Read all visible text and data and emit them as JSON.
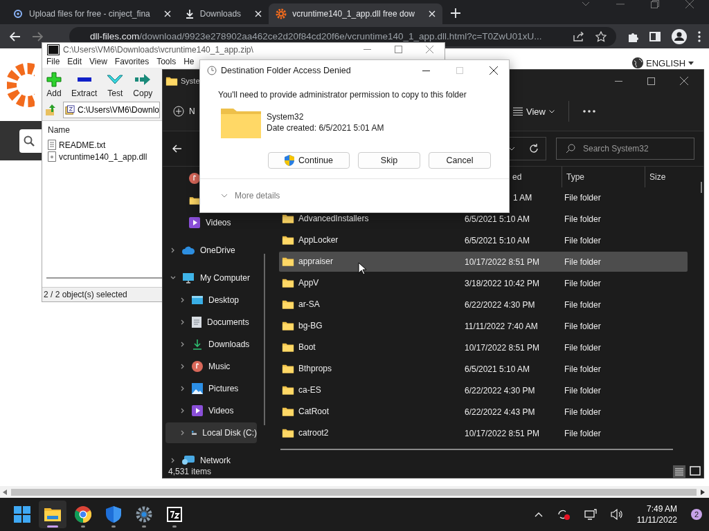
{
  "browser": {
    "tabs": [
      {
        "title": "Upload files for free - cinject_fina",
        "kind": "cloud",
        "selected": false
      },
      {
        "title": "Downloads",
        "kind": "download",
        "selected": false
      },
      {
        "title": "vcruntime140_1_app.dll free dow",
        "kind": "gear",
        "selected": true
      }
    ],
    "address": {
      "host": "dll-files.com",
      "path": "/download/9923e278902aa462ce2d20f84cd20f6e/vcruntime140_1_app.dll.html?c=T0ZwU01xU..."
    },
    "language": "ENGLISH"
  },
  "archive_window": {
    "title": "C:\\Users\\VM6\\Downloads\\vcruntime140_1_app.zip\\",
    "menu": [
      "File",
      "Edit",
      "View",
      "Favorites",
      "Tools",
      "He"
    ],
    "toolbar": [
      {
        "label": "Add",
        "kind": "add"
      },
      {
        "label": "Extract",
        "kind": "extract"
      },
      {
        "label": "Test",
        "kind": "test"
      },
      {
        "label": "Copy",
        "kind": "copy"
      }
    ],
    "path": "C:\\Users\\VM6\\Downlo",
    "column": "Name",
    "files": [
      {
        "name": "README.txt",
        "kind": "text"
      },
      {
        "name": "vcruntime140_1_app.dll",
        "kind": "dll"
      }
    ],
    "status": "2 / 2 object(s) selected"
  },
  "explorer": {
    "title": "Syste",
    "new_button": "N",
    "view_button": "View",
    "search": {
      "placeholder": "Search System32"
    },
    "quick_access": [
      {
        "kind": "music",
        "selected": false
      },
      {
        "kind": "folder",
        "selected": false
      },
      {
        "label": "Videos",
        "kind": "videos",
        "selected": false
      }
    ],
    "tree": [
      {
        "label": "OneDrive",
        "kind": "cloud",
        "expanded": false,
        "selected": false
      },
      {
        "label": "My Computer",
        "kind": "monitor",
        "expanded": true,
        "selected": false,
        "children": [
          {
            "label": "Desktop",
            "kind": "desktop",
            "expanded": false,
            "selected": false
          },
          {
            "label": "Documents",
            "kind": "documents",
            "expanded": false,
            "selected": false
          },
          {
            "label": "Downloads",
            "kind": "download",
            "expanded": false,
            "selected": false
          },
          {
            "label": "Music",
            "kind": "music",
            "expanded": false,
            "selected": false
          },
          {
            "label": "Pictures",
            "kind": "pictures",
            "expanded": false,
            "selected": false
          },
          {
            "label": "Videos",
            "kind": "videos",
            "expanded": false,
            "selected": false
          },
          {
            "label": "Local Disk (C:)",
            "kind": "disk",
            "expanded": false,
            "selected": true
          }
        ]
      },
      {
        "label": "Network",
        "kind": "network",
        "expanded": false,
        "selected": false
      }
    ],
    "columns": [
      "ed",
      "Type",
      "Size"
    ],
    "rows": [
      {
        "modified": "1 AM",
        "type": "File folder",
        "selected": false
      },
      {
        "name": "AdvancedInstallers",
        "modified": "6/5/2021 5:10 AM",
        "type": "File folder",
        "selected": false
      },
      {
        "name": "AppLocker",
        "modified": "6/5/2021 5:10 AM",
        "type": "File folder",
        "selected": false
      },
      {
        "name": "appraiser",
        "modified": "10/17/2022 8:51 PM",
        "type": "File folder",
        "selected": true
      },
      {
        "name": "AppV",
        "modified": "3/18/2022 10:42 PM",
        "type": "File folder",
        "selected": false
      },
      {
        "name": "ar-SA",
        "modified": "6/22/2022 4:30 PM",
        "type": "File folder",
        "selected": false
      },
      {
        "name": "bg-BG",
        "modified": "11/11/2022 7:40 AM",
        "type": "File folder",
        "selected": false
      },
      {
        "name": "Boot",
        "modified": "10/17/2022 8:51 PM",
        "type": "File folder",
        "selected": false
      },
      {
        "name": "Bthprops",
        "modified": "6/5/2021 5:10 AM",
        "type": "File folder",
        "selected": false
      },
      {
        "name": "ca-ES",
        "modified": "6/22/2022 4:30 PM",
        "type": "File folder",
        "selected": false
      },
      {
        "name": "CatRoot",
        "modified": "6/22/2022 4:43 PM",
        "type": "File folder",
        "selected": false
      },
      {
        "name": "catroot2",
        "modified": "10/17/2022 8:51 PM",
        "type": "File folder",
        "selected": false
      }
    ],
    "status": "4,531 items"
  },
  "dialog": {
    "title": "Destination Folder Access Denied",
    "message": "You'll need to provide administrator permission to copy to this folder",
    "folder": {
      "name": "System32",
      "created": "Date created: 6/5/2021 5:01 AM"
    },
    "buttons": [
      {
        "label": "Continue",
        "kind": "shield"
      },
      {
        "label": "Skip",
        "kind": "plain"
      },
      {
        "label": "Cancel",
        "kind": "plain"
      }
    ],
    "details": "More details"
  },
  "taskbar": {
    "apps": [
      {
        "kind": "explorer",
        "active": true
      },
      {
        "kind": "chrome",
        "active": false
      },
      {
        "kind": "shield",
        "active": false
      },
      {
        "kind": "settings",
        "active": false
      },
      {
        "kind": "sevenzip",
        "active": false
      }
    ],
    "time": "7:49 AM",
    "date": "11/11/2022",
    "notifications": "2"
  }
}
